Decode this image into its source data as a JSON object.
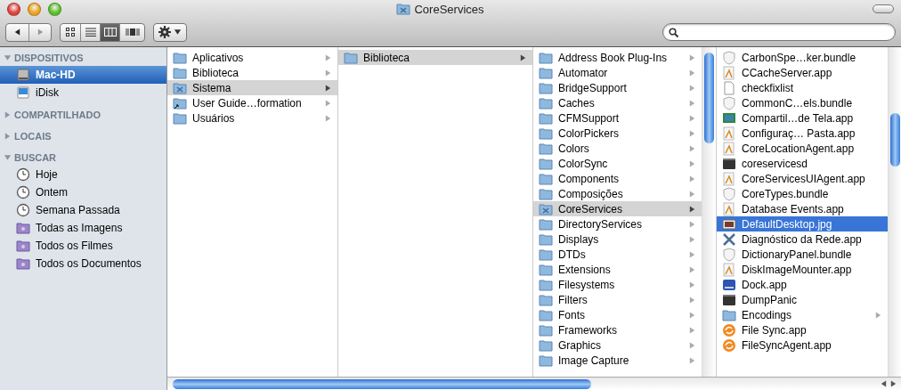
{
  "window": {
    "title": "CoreServices"
  },
  "toolbar": {
    "nav": [
      {
        "kind": "back",
        "disabled": false
      },
      {
        "kind": "forward",
        "disabled": true
      }
    ],
    "views": [
      {
        "kind": "icons",
        "selected": false
      },
      {
        "kind": "list",
        "selected": false
      },
      {
        "kind": "columns",
        "selected": true
      },
      {
        "kind": "coverflow",
        "selected": false
      }
    ]
  },
  "sidebar": {
    "sections": [
      {
        "title": "DISPOSITIVOS",
        "expanded": true,
        "items": [
          {
            "label": "Mac-HD",
            "kind": "disk",
            "selected": true
          },
          {
            "label": "iDisk",
            "kind": "idisk",
            "selected": false
          }
        ]
      },
      {
        "title": "COMPARTILHADO",
        "expanded": false
      },
      {
        "title": "LOCAIS",
        "expanded": false
      },
      {
        "title": "BUSCAR",
        "expanded": true,
        "items": [
          {
            "label": "Hoje",
            "kind": "clock",
            "selected": false
          },
          {
            "label": "Ontem",
            "kind": "clock",
            "selected": false
          },
          {
            "label": "Semana Passada",
            "kind": "clock",
            "selected": false
          },
          {
            "label": "Todas as Imagens",
            "kind": "smart",
            "selected": false
          },
          {
            "label": "Todos os Filmes",
            "kind": "smart",
            "selected": false
          },
          {
            "label": "Todos os Documentos",
            "kind": "smart",
            "selected": false
          }
        ]
      }
    ]
  },
  "columns": [
    {
      "focused": false,
      "items": [
        {
          "name": "Aplicativos",
          "kind": "folder",
          "selected": false,
          "has_children": true
        },
        {
          "name": "Biblioteca",
          "kind": "folder",
          "selected": false,
          "has_children": true
        },
        {
          "name": "Sistema",
          "kind": "system",
          "selected": true,
          "has_children": true
        },
        {
          "name": "User Guide…formation",
          "kind": "alias",
          "selected": false,
          "has_children": true
        },
        {
          "name": "Usuários",
          "kind": "folder",
          "selected": false,
          "has_children": true
        }
      ]
    },
    {
      "focused": false,
      "items": [
        {
          "name": "Biblioteca",
          "kind": "folder",
          "selected": true,
          "has_children": true
        }
      ]
    },
    {
      "focused": false,
      "items": [
        {
          "name": "Address Book Plug-Ins",
          "kind": "folder",
          "selected": false,
          "has_children": true
        },
        {
          "name": "Automator",
          "kind": "folder",
          "selected": false,
          "has_children": true
        },
        {
          "name": "BridgeSupport",
          "kind": "folder",
          "selected": false,
          "has_children": true
        },
        {
          "name": "Caches",
          "kind": "folder",
          "selected": false,
          "has_children": true
        },
        {
          "name": "CFMSupport",
          "kind": "folder",
          "selected": false,
          "has_children": true
        },
        {
          "name": "ColorPickers",
          "kind": "folder",
          "selected": false,
          "has_children": true
        },
        {
          "name": "Colors",
          "kind": "folder",
          "selected": false,
          "has_children": true
        },
        {
          "name": "ColorSync",
          "kind": "folder",
          "selected": false,
          "has_children": true
        },
        {
          "name": "Components",
          "kind": "folder",
          "selected": false,
          "has_children": true
        },
        {
          "name": "Composições",
          "kind": "folder",
          "selected": false,
          "has_children": true
        },
        {
          "name": "CoreServices",
          "kind": "system",
          "selected": true,
          "has_children": true
        },
        {
          "name": "DirectoryServices",
          "kind": "folder",
          "selected": false,
          "has_children": true
        },
        {
          "name": "Displays",
          "kind": "folder",
          "selected": false,
          "has_children": true
        },
        {
          "name": "DTDs",
          "kind": "folder",
          "selected": false,
          "has_children": true
        },
        {
          "name": "Extensions",
          "kind": "folder",
          "selected": false,
          "has_children": true
        },
        {
          "name": "Filesystems",
          "kind": "folder",
          "selected": false,
          "has_children": true
        },
        {
          "name": "Filters",
          "kind": "folder",
          "selected": false,
          "has_children": true
        },
        {
          "name": "Fonts",
          "kind": "folder",
          "selected": false,
          "has_children": true
        },
        {
          "name": "Frameworks",
          "kind": "folder",
          "selected": false,
          "has_children": true
        },
        {
          "name": "Graphics",
          "kind": "folder",
          "selected": false,
          "has_children": true
        },
        {
          "name": "Image Capture",
          "kind": "folder",
          "selected": false,
          "has_children": true
        }
      ]
    },
    {
      "focused": true,
      "items": [
        {
          "name": "CarbonSpe…ker.bundle",
          "kind": "bundle",
          "selected": false,
          "has_children": false
        },
        {
          "name": "CCacheServer.app",
          "kind": "app",
          "selected": false,
          "has_children": false
        },
        {
          "name": "checkfixlist",
          "kind": "file",
          "selected": false,
          "has_children": false
        },
        {
          "name": "CommonC…els.bundle",
          "kind": "bundle",
          "selected": false,
          "has_children": false
        },
        {
          "name": "Compartil…de Tela.app",
          "kind": "screen",
          "selected": false,
          "has_children": false
        },
        {
          "name": "Configuraç… Pasta.app",
          "kind": "app",
          "selected": false,
          "has_children": false
        },
        {
          "name": "CoreLocationAgent.app",
          "kind": "app",
          "selected": false,
          "has_children": false
        },
        {
          "name": "coreservicesd",
          "kind": "exec",
          "selected": false,
          "has_children": false
        },
        {
          "name": "CoreServicesUIAgent.app",
          "kind": "app",
          "selected": false,
          "has_children": false
        },
        {
          "name": "CoreTypes.bundle",
          "kind": "bundle",
          "selected": false,
          "has_children": false
        },
        {
          "name": "Database Events.app",
          "kind": "app",
          "selected": false,
          "has_children": false
        },
        {
          "name": "DefaultDesktop.jpg",
          "kind": "image",
          "selected": true,
          "has_children": false
        },
        {
          "name": "Diagnóstico da Rede.app",
          "kind": "tool",
          "selected": false,
          "has_children": false
        },
        {
          "name": "DictionaryPanel.bundle",
          "kind": "bundle",
          "selected": false,
          "has_children": false
        },
        {
          "name": "DiskImageMounter.app",
          "kind": "app",
          "selected": false,
          "has_children": false
        },
        {
          "name": "Dock.app",
          "kind": "dock",
          "selected": false,
          "has_children": false
        },
        {
          "name": "DumpPanic",
          "kind": "exec",
          "selected": false,
          "has_children": false
        },
        {
          "name": "Encodings",
          "kind": "folder",
          "selected": false,
          "has_children": true
        },
        {
          "name": "File Sync.app",
          "kind": "sync",
          "selected": false,
          "has_children": false
        },
        {
          "name": "FileSyncAgent.app",
          "kind": "sync",
          "selected": false,
          "has_children": false
        }
      ]
    }
  ]
}
